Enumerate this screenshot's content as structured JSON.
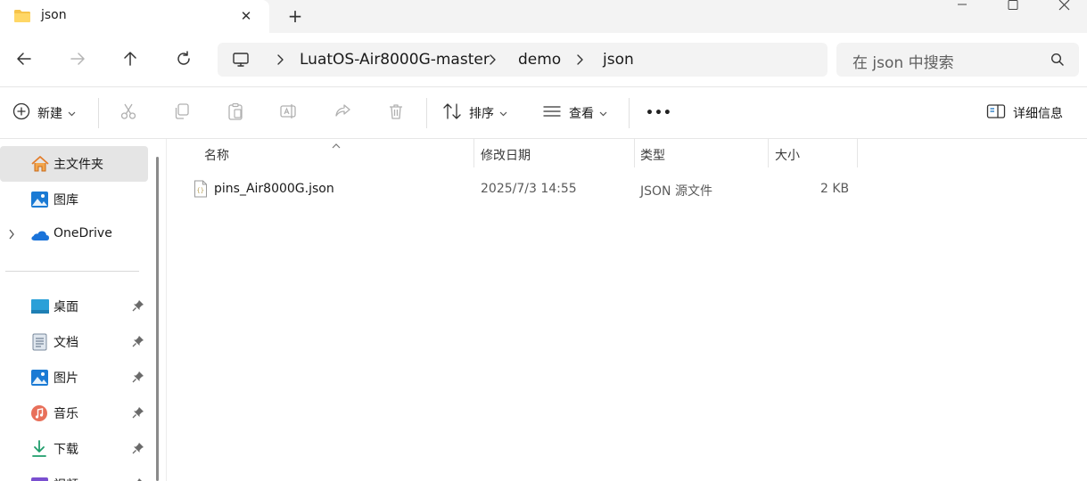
{
  "window": {
    "tab_title": "json",
    "new_tab_symbol": "+"
  },
  "breadcrumb": [
    "LuatOS-Air8000G-master",
    "demo",
    "json"
  ],
  "search": {
    "placeholder": "在 json 中搜索"
  },
  "toolbar": {
    "new_label": "新建",
    "sort_label": "排序",
    "view_label": "查看",
    "more_label": "•••",
    "details_label": "详细信息"
  },
  "nav": {
    "top_items": [
      {
        "label": "主文件夹",
        "icon": "home-icon",
        "selected": true
      },
      {
        "label": "图库",
        "icon": "gallery-icon"
      },
      {
        "label": "OneDrive",
        "icon": "onedrive-icon",
        "expandable": true
      }
    ],
    "quick_access": [
      {
        "label": "桌面",
        "icon": "desktop-icon",
        "pinned": true
      },
      {
        "label": "文档",
        "icon": "documents-icon",
        "pinned": true
      },
      {
        "label": "图片",
        "icon": "pictures-icon",
        "pinned": true
      },
      {
        "label": "音乐",
        "icon": "music-icon",
        "pinned": true
      },
      {
        "label": "下载",
        "icon": "downloads-icon",
        "pinned": true
      },
      {
        "label": "视频",
        "icon": "videos-icon",
        "pinned": true
      }
    ]
  },
  "columns": {
    "name": "名称",
    "modified": "修改日期",
    "type": "类型",
    "size": "大小"
  },
  "files": [
    {
      "name": "pins_Air8000G.json",
      "modified": "2025/7/3 14:55",
      "type": "JSON 源文件",
      "size": "2 KB",
      "icon": "json-file-icon"
    }
  ],
  "colors": {
    "selection_bg": "#e5e5e5",
    "chrome_bg": "#f3f3f3",
    "folder_yellow": "#f6c34a",
    "accent_blue": "#0f6cbd"
  }
}
